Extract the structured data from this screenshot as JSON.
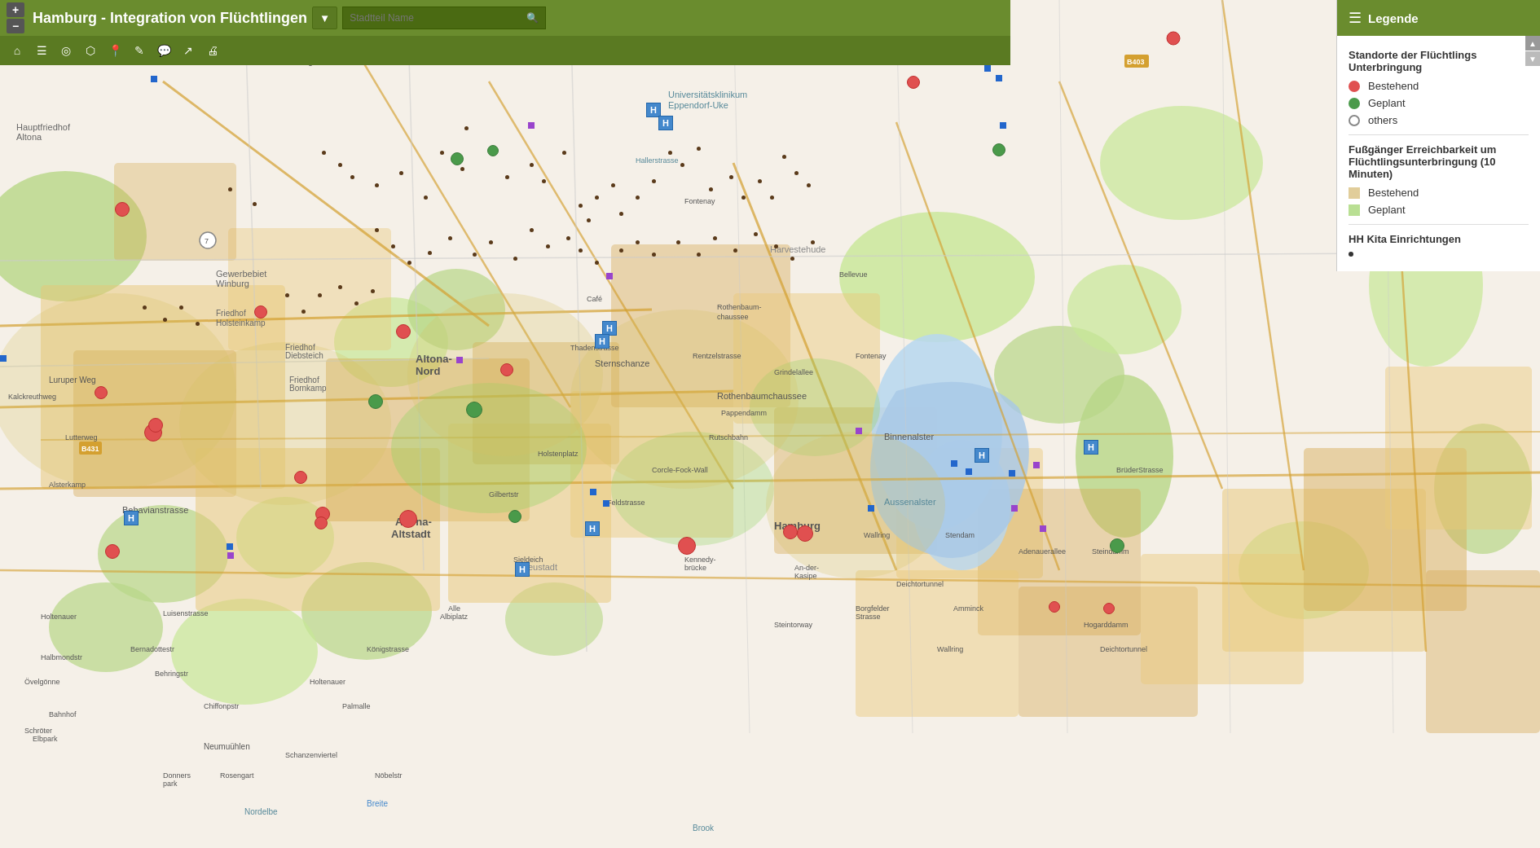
{
  "app": {
    "title": "Hamburg - Integration von Flüchtlingen",
    "dropdown_label": "▼",
    "search_placeholder": "Stadtteil Name"
  },
  "toolbar": {
    "tools": [
      {
        "name": "home",
        "icon": "⌂"
      },
      {
        "name": "layers",
        "icon": "☰"
      },
      {
        "name": "circle-layers",
        "icon": "◎"
      },
      {
        "name": "polygon",
        "icon": "⬡"
      },
      {
        "name": "pencil",
        "icon": "✎"
      },
      {
        "name": "comment",
        "icon": "💬"
      },
      {
        "name": "share",
        "icon": "↗"
      },
      {
        "name": "print",
        "icon": "🖨"
      }
    ]
  },
  "legend": {
    "title": "Legende",
    "sections": [
      {
        "title": "Standorte der Flüchtlings Unterbringung",
        "items": [
          {
            "label": "Bestehend",
            "type": "dot-red"
          },
          {
            "label": "Geplant",
            "type": "dot-green"
          },
          {
            "label": "others",
            "type": "dot-empty"
          }
        ]
      },
      {
        "title": "Fußgänger Erreichbarkeit um Flüchtlingsunterbringung (10 Minuten)",
        "items": [
          {
            "label": "Bestehend",
            "type": "sq-tan"
          },
          {
            "label": "Geplant",
            "type": "sq-ltgreen"
          }
        ]
      },
      {
        "title": "HH Kita Einrichtungen",
        "items": [
          {
            "label": "",
            "type": "dot-small"
          }
        ]
      }
    ]
  },
  "map": {
    "zoom_in": "+",
    "zoom_out": "−"
  }
}
